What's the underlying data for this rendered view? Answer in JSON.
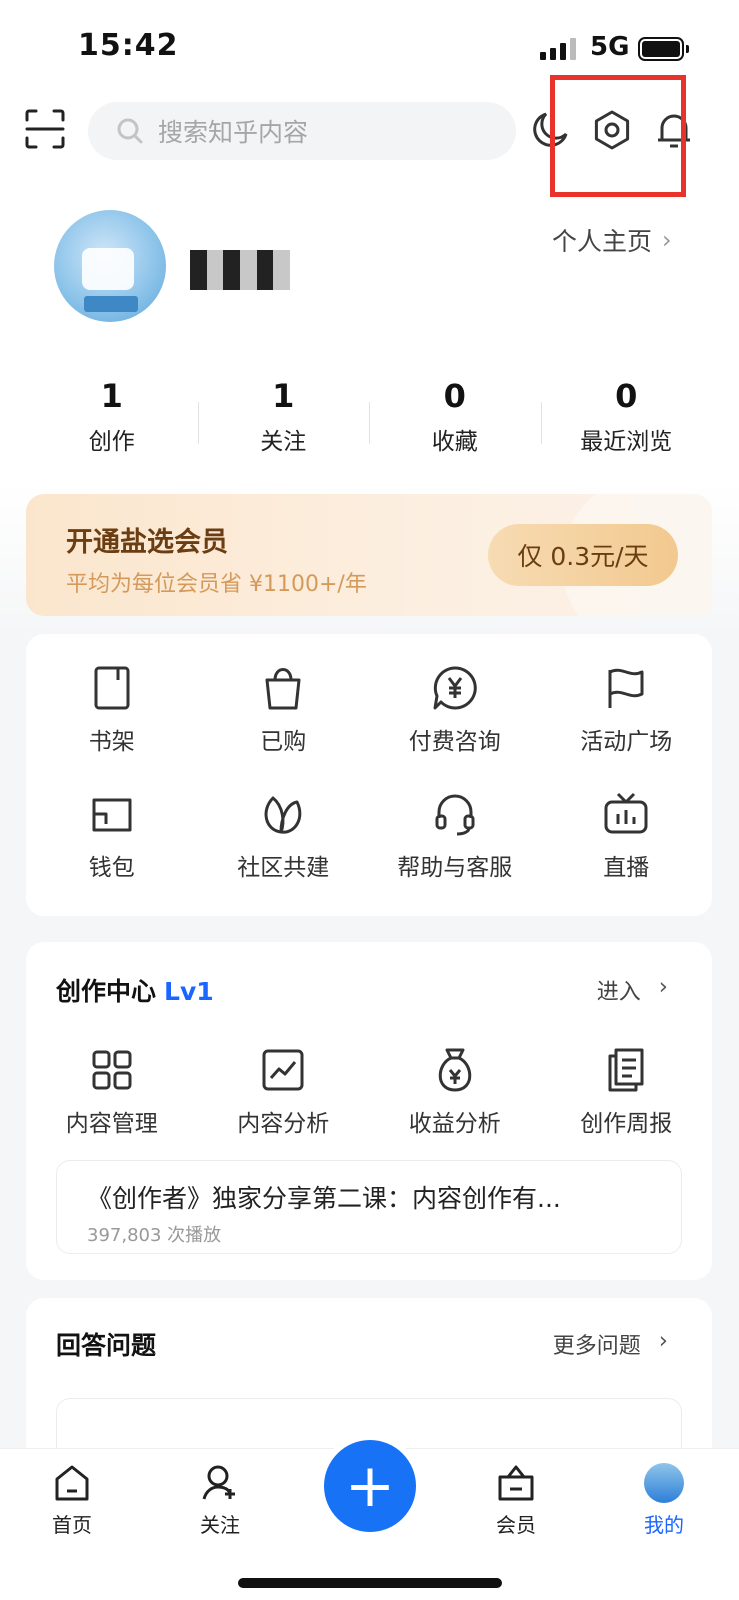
{
  "status_bar": {
    "time": "15:42",
    "network": "5G"
  },
  "header": {
    "search_placeholder": "搜索知乎内容"
  },
  "profile": {
    "homepage_link": "个人主页"
  },
  "stats": [
    {
      "value": "1",
      "label": "创作"
    },
    {
      "value": "1",
      "label": "关注"
    },
    {
      "value": "0",
      "label": "收藏"
    },
    {
      "value": "0",
      "label": "最近浏览"
    }
  ],
  "vip_banner": {
    "title": "开通盐选会员",
    "subtitle": "平均为每位会员省 ¥1100+/年",
    "button": "仅 0.3元/天"
  },
  "tools": [
    {
      "label": "书架",
      "icon": "bookshelf-icon"
    },
    {
      "label": "已购",
      "icon": "shopping-bag-icon"
    },
    {
      "label": "付费咨询",
      "icon": "paid-consult-icon"
    },
    {
      "label": "活动广场",
      "icon": "flag-icon"
    },
    {
      "label": "钱包",
      "icon": "wallet-icon"
    },
    {
      "label": "社区共建",
      "icon": "leaf-icon"
    },
    {
      "label": "帮助与客服",
      "icon": "headset-icon"
    },
    {
      "label": "直播",
      "icon": "tv-icon"
    }
  ],
  "creation_center": {
    "title": "创作中心",
    "level": "Lv1",
    "enter": "进入",
    "items": [
      {
        "label": "内容管理",
        "icon": "grid-icon"
      },
      {
        "label": "内容分析",
        "icon": "chart-icon"
      },
      {
        "label": "收益分析",
        "icon": "money-bag-icon"
      },
      {
        "label": "创作周报",
        "icon": "report-icon"
      }
    ],
    "recommend": {
      "title": "《创作者》独家分享第二课：内容创作有...",
      "plays": "397,803 次播放"
    }
  },
  "answer_section": {
    "title": "回答问题",
    "more": "更多问题"
  },
  "bottom_nav": [
    {
      "label": "首页",
      "icon": "home-icon"
    },
    {
      "label": "关注",
      "icon": "follow-icon"
    },
    {
      "label": "会员",
      "icon": "vip-icon"
    },
    {
      "label": "我的",
      "icon": "me-icon"
    }
  ],
  "colors": {
    "accent": "#1772f6",
    "highlight_box": "#e8332b",
    "vip_text": "#6b3d12"
  }
}
